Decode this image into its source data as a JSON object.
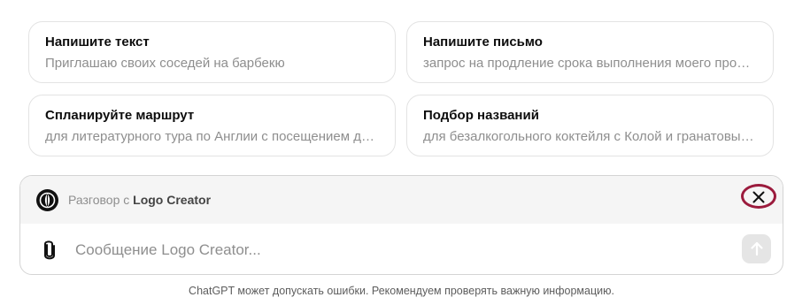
{
  "suggestions": [
    {
      "title": "Напишите текст",
      "subtitle": "Приглашаю своих соседей на барбекю"
    },
    {
      "title": "Напишите письмо",
      "subtitle": "запрос на продление срока выполнения моего проекта"
    },
    {
      "title": "Спланируйте маршрут",
      "subtitle": "для литературного тура по Англии с посещением достопримечательностей"
    },
    {
      "title": "Подбор названий",
      "subtitle": "для безалкогольного коктейля с Колой и гранатовым соком"
    }
  ],
  "composer": {
    "gpt_prefix": "Разговор с",
    "gpt_name": "Logo Creator",
    "close_icon": "close-icon",
    "attach_icon": "paperclip-icon",
    "message_placeholder": "Сообщение Logo Creator...",
    "send_icon": "arrow-up-icon"
  },
  "footer": {
    "disclaimer": "ChatGPT может допускать ошибки. Рекомендуем проверять важную информацию."
  },
  "colors": {
    "highlight_ring": "#9b1b3d",
    "muted_text": "#8e8e8e"
  }
}
